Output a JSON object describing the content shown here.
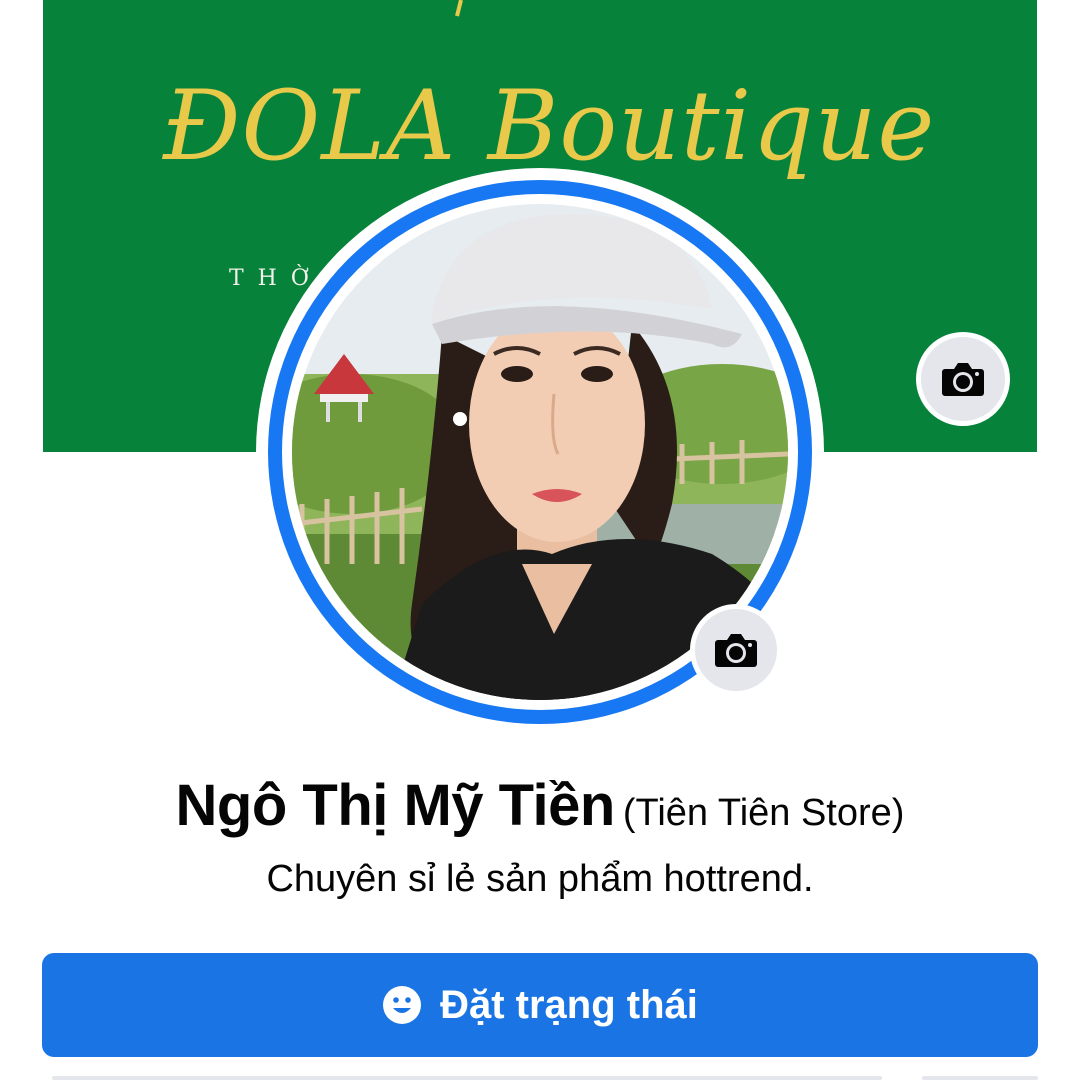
{
  "cover": {
    "title": "ĐOLA Boutique",
    "tagline": "THỜ              ẸP",
    "background_color": "#06823a",
    "title_color": "#e8c94a",
    "camera_icon": "camera-icon"
  },
  "profile": {
    "avatar_ring_color": "#1877f2",
    "camera_icon": "camera-icon",
    "name": "Ngô Thị Mỹ Tiền",
    "alternate_name": "(Tiên Tiên Store)",
    "bio": "Chuyên sỉ lẻ sản phẩm hottrend."
  },
  "actions": {
    "status_button_label": "Đặt trạng thái",
    "status_button_icon": "smile-icon",
    "button_color": "#1b74e4"
  }
}
